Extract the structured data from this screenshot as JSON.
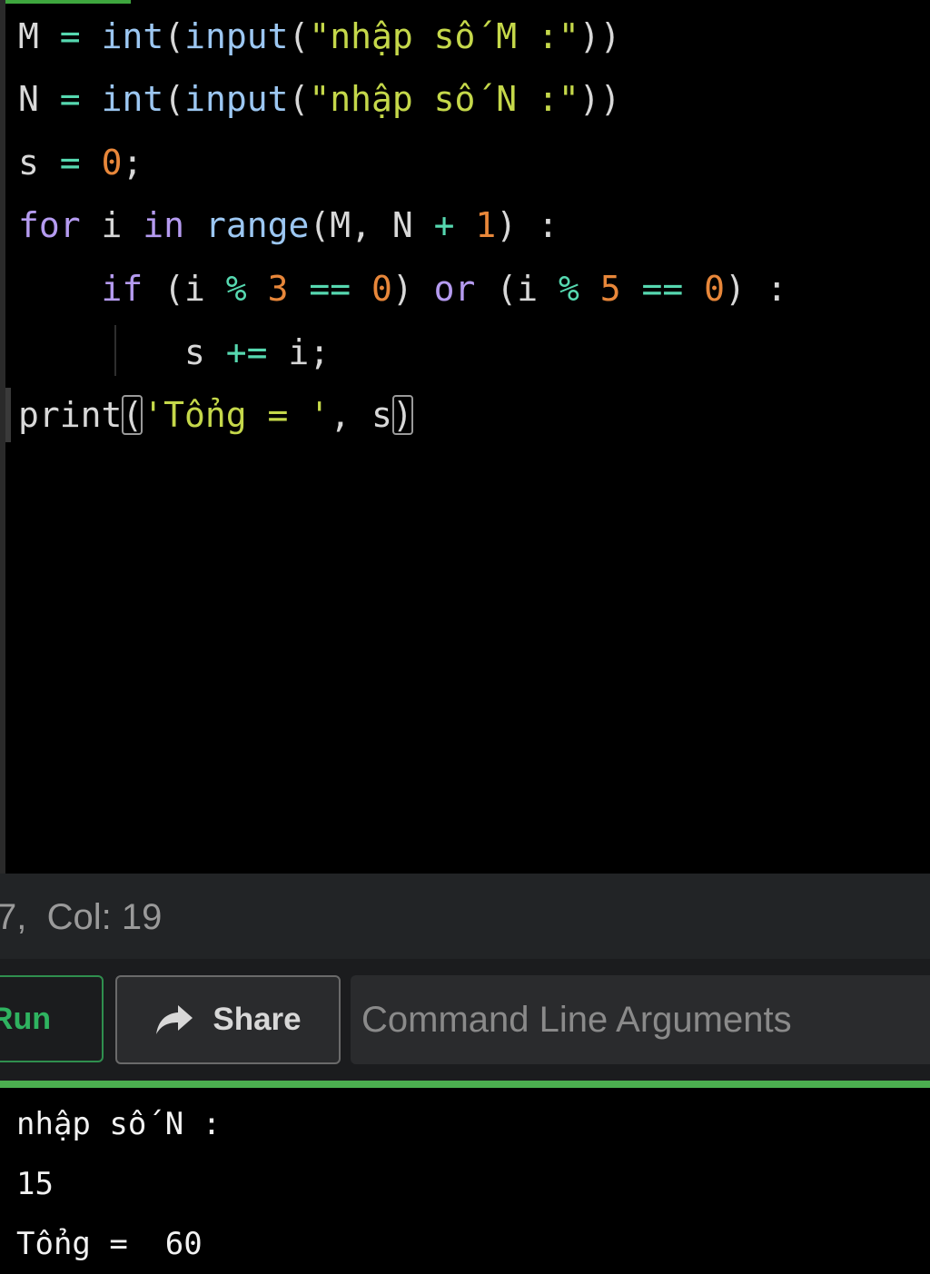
{
  "editor": {
    "lines": [
      [
        {
          "t": "M",
          "c": "id"
        },
        {
          "t": " ",
          "c": "id"
        },
        {
          "t": "=",
          "c": "op"
        },
        {
          "t": " ",
          "c": "id"
        },
        {
          "t": "int",
          "c": "fn"
        },
        {
          "t": "(",
          "c": "pun"
        },
        {
          "t": "input",
          "c": "fn"
        },
        {
          "t": "(",
          "c": "pun"
        },
        {
          "t": "\"nhập số M :\"",
          "c": "str"
        },
        {
          "t": "))",
          "c": "pun"
        }
      ],
      [
        {
          "t": "N",
          "c": "id"
        },
        {
          "t": " ",
          "c": "id"
        },
        {
          "t": "=",
          "c": "op"
        },
        {
          "t": " ",
          "c": "id"
        },
        {
          "t": "int",
          "c": "fn"
        },
        {
          "t": "(",
          "c": "pun"
        },
        {
          "t": "input",
          "c": "fn"
        },
        {
          "t": "(",
          "c": "pun"
        },
        {
          "t": "\"nhập số N :\"",
          "c": "str"
        },
        {
          "t": "))",
          "c": "pun"
        }
      ],
      [
        {
          "t": "s",
          "c": "id"
        },
        {
          "t": " ",
          "c": "id"
        },
        {
          "t": "=",
          "c": "op"
        },
        {
          "t": " ",
          "c": "id"
        },
        {
          "t": "0",
          "c": "num"
        },
        {
          "t": ";",
          "c": "pun"
        }
      ],
      [
        {
          "t": "for",
          "c": "kw"
        },
        {
          "t": " i ",
          "c": "id"
        },
        {
          "t": "in",
          "c": "kw"
        },
        {
          "t": " ",
          "c": "id"
        },
        {
          "t": "range",
          "c": "fn"
        },
        {
          "t": "(M, N ",
          "c": "pun"
        },
        {
          "t": "+",
          "c": "op"
        },
        {
          "t": " ",
          "c": "id"
        },
        {
          "t": "1",
          "c": "num"
        },
        {
          "t": ") :",
          "c": "pun"
        }
      ],
      [
        {
          "t": "    ",
          "c": "id"
        },
        {
          "t": "if",
          "c": "kw"
        },
        {
          "t": " (i ",
          "c": "pun"
        },
        {
          "t": "%",
          "c": "op"
        },
        {
          "t": " ",
          "c": "id"
        },
        {
          "t": "3",
          "c": "num"
        },
        {
          "t": " ",
          "c": "id"
        },
        {
          "t": "==",
          "c": "op"
        },
        {
          "t": " ",
          "c": "id"
        },
        {
          "t": "0",
          "c": "num"
        },
        {
          "t": ") ",
          "c": "pun"
        },
        {
          "t": "or",
          "c": "kw"
        },
        {
          "t": " (i ",
          "c": "pun"
        },
        {
          "t": "%",
          "c": "op"
        },
        {
          "t": " ",
          "c": "id"
        },
        {
          "t": "5",
          "c": "num"
        },
        {
          "t": " ",
          "c": "id"
        },
        {
          "t": "==",
          "c": "op"
        },
        {
          "t": " ",
          "c": "id"
        },
        {
          "t": "0",
          "c": "num"
        },
        {
          "t": ") :",
          "c": "pun"
        }
      ],
      [
        {
          "t": "        s ",
          "c": "id"
        },
        {
          "t": "+=",
          "c": "op"
        },
        {
          "t": " i;",
          "c": "id"
        }
      ],
      [
        {
          "t": "print",
          "c": "id"
        },
        {
          "t": "(",
          "c": "pun",
          "box": true
        },
        {
          "t": "'Tổng = '",
          "c": "str"
        },
        {
          "t": ", ",
          "c": "pun"
        },
        {
          "t": "s",
          "c": "id"
        },
        {
          "t": ")",
          "c": "pun",
          "box": true
        }
      ]
    ]
  },
  "status": {
    "cursor_text": "7,  Col: 19"
  },
  "toolbar": {
    "run_label": "Run",
    "share_label": "Share",
    "share_icon": "share-arrow-icon",
    "cmd_placeholder": "Command Line Arguments"
  },
  "output": {
    "lines": [
      "nhập số N :",
      "15",
      "Tổng =  60"
    ]
  },
  "colors": {
    "accent": "#4caf50",
    "run_green": "#2fb360"
  }
}
